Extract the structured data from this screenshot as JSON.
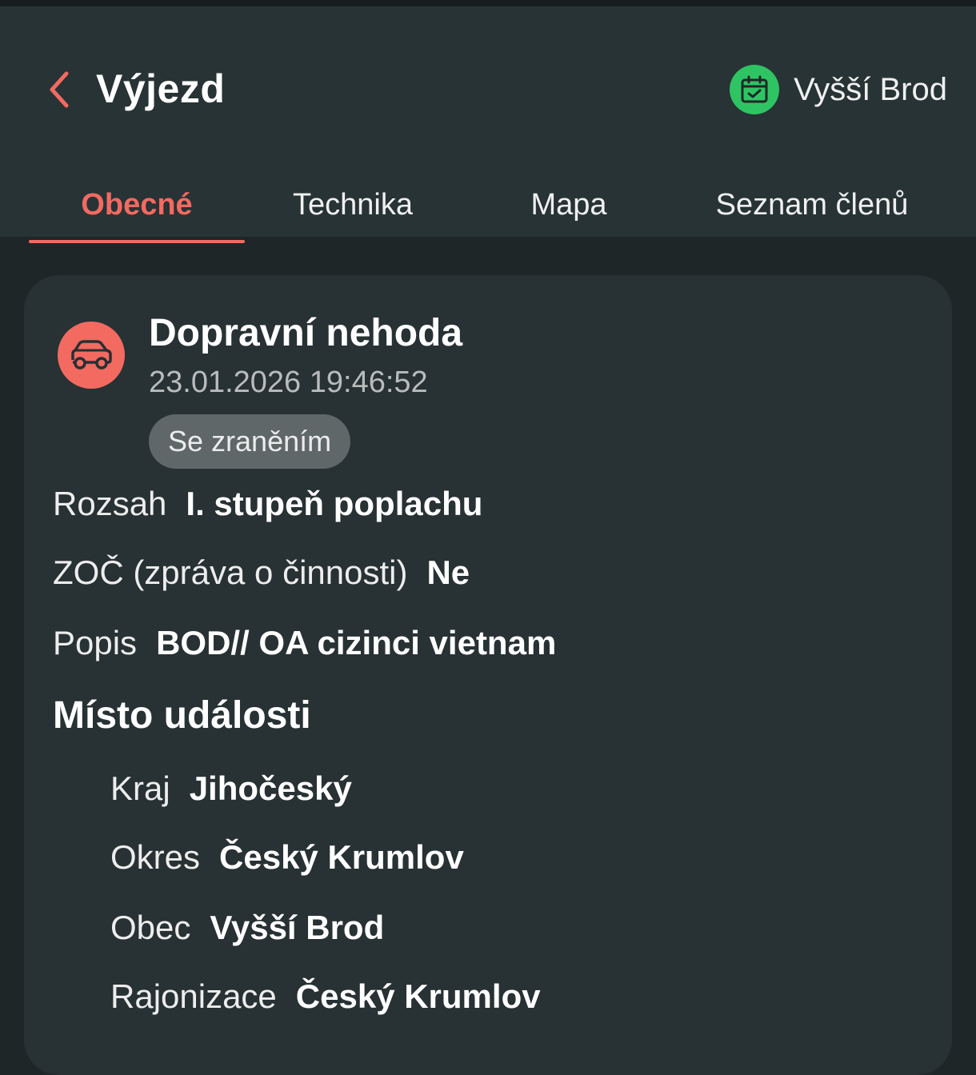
{
  "header": {
    "title": "Výjezd",
    "back_icon": "chevron-left-icon",
    "station_icon": "calendar-check-icon",
    "station_name": "Vyšší Brod",
    "accent_color": "#f36a61",
    "station_icon_color": "#2fc463"
  },
  "tabs": [
    {
      "label": "Obecné",
      "active": true
    },
    {
      "label": "Technika",
      "active": false
    },
    {
      "label": "Mapa",
      "active": false
    },
    {
      "label": "Seznam členů",
      "active": false
    }
  ],
  "incident": {
    "icon": "car-icon",
    "title": "Dopravní nehoda",
    "datetime": "23.01.2026 19:46:52",
    "badge": "Se zraněním"
  },
  "details": [
    {
      "label": "Rozsah",
      "value": "I. stupeň poplachu"
    },
    {
      "label": "ZOČ (zpráva o činnosti)",
      "value": "Ne"
    },
    {
      "label": "Popis",
      "value": "BOD// OA cizinci vietnam"
    }
  ],
  "location": {
    "heading": "Místo události",
    "items": [
      {
        "label": "Kraj",
        "value": "Jihočeský"
      },
      {
        "label": "Okres",
        "value": "Český Krumlov"
      },
      {
        "label": "Obec",
        "value": "Vyšší Brod"
      },
      {
        "label": "Rajonizace",
        "value": "Český Krumlov"
      }
    ]
  }
}
